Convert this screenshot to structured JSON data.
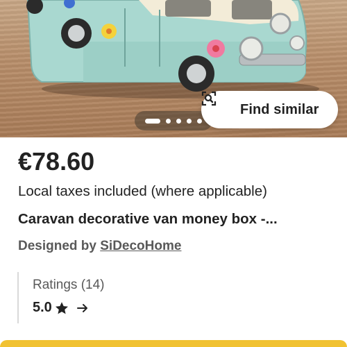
{
  "product": {
    "price": "€78.60",
    "taxes_note": "Local taxes included (where applicable)",
    "title": "Caravan decorative van money box -...",
    "designed_by_prefix": "Designed by ",
    "shop_name": "SiDecoHome"
  },
  "gallery": {
    "find_similar_label": "Find similar",
    "find_similar_icon": "image-search-icon",
    "image_count": 5,
    "active_index": 0
  },
  "ratings": {
    "label": "Ratings (14)",
    "value": "5.0",
    "star_icon": "star-icon",
    "arrow_icon": "arrow-right-icon"
  },
  "colors": {
    "text": "#222222",
    "muted_text": "#595959",
    "bottom_bar": "#f1c232"
  }
}
